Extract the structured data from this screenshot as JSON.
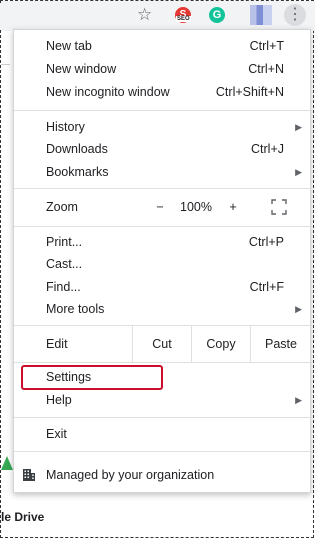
{
  "toolbar": {
    "icons": [
      "star-icon",
      "seo-extension-icon",
      "grammarly-extension-icon",
      "profile-avatar",
      "more-menu-icon"
    ],
    "seo_badge": "SEO",
    "grammarly_letter": "G",
    "star_glyph": "☆",
    "kebab_glyph": "⋮"
  },
  "page": {
    "partial_text": "le Drive"
  },
  "menu": {
    "new_tab": {
      "label": "New tab",
      "shortcut": "Ctrl+T"
    },
    "new_window": {
      "label": "New window",
      "shortcut": "Ctrl+N"
    },
    "new_incognito": {
      "label": "New incognito window",
      "shortcut": "Ctrl+Shift+N"
    },
    "history": {
      "label": "History"
    },
    "downloads": {
      "label": "Downloads",
      "shortcut": "Ctrl+J"
    },
    "bookmarks": {
      "label": "Bookmarks"
    },
    "zoom": {
      "label": "Zoom",
      "minus": "−",
      "value": "100%",
      "plus": "+"
    },
    "print": {
      "label": "Print...",
      "shortcut": "Ctrl+P"
    },
    "cast": {
      "label": "Cast..."
    },
    "find": {
      "label": "Find...",
      "shortcut": "Ctrl+F"
    },
    "more_tools": {
      "label": "More tools"
    },
    "edit": {
      "label": "Edit",
      "cut": "Cut",
      "copy": "Copy",
      "paste": "Paste"
    },
    "settings": {
      "label": "Settings"
    },
    "help": {
      "label": "Help"
    },
    "exit": {
      "label": "Exit"
    },
    "managed": {
      "label": "Managed by your organization"
    },
    "submenu_arrow": "▶"
  },
  "colors": {
    "highlight_border": "#c8102e",
    "toolbar_bg": "#f1f3f4"
  }
}
